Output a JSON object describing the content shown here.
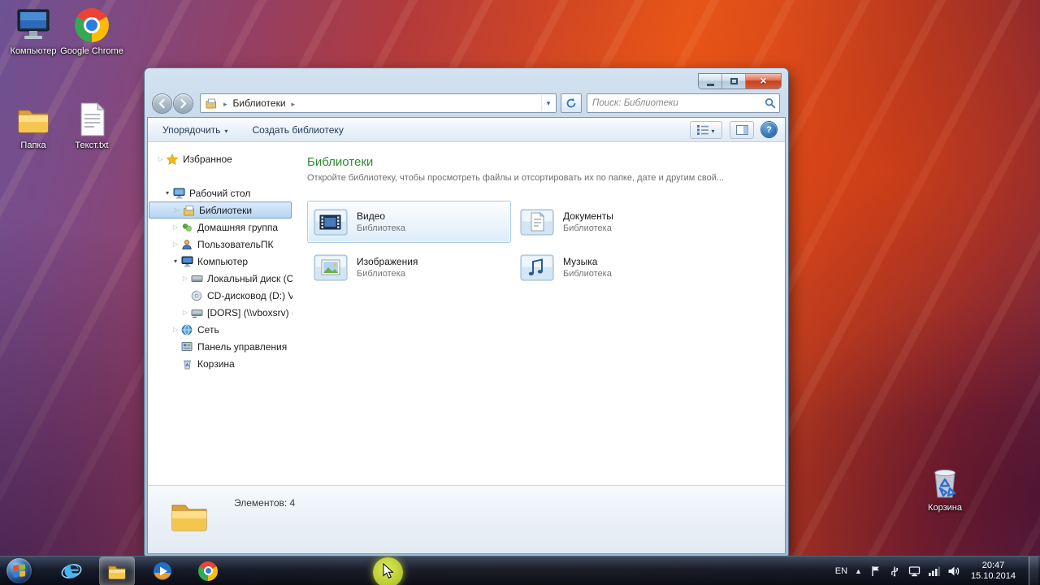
{
  "desktop": {
    "icons": [
      {
        "label": "Компьютер",
        "icon": "computer-icon"
      },
      {
        "label": "Google Chrome",
        "icon": "chrome-icon"
      },
      {
        "label": "Папка",
        "icon": "folder-icon"
      },
      {
        "label": "Текст.txt",
        "icon": "text-file-icon"
      },
      {
        "label": "Корзина",
        "icon": "recycle-bin-icon"
      }
    ]
  },
  "explorer": {
    "window_controls": [
      "minimize",
      "maximize",
      "close"
    ],
    "address": {
      "breadcrumb": "Библиотеки"
    },
    "search": {
      "placeholder": "Поиск: Библиотеки"
    },
    "toolbar": {
      "organize": "Упорядочить",
      "create_library": "Создать библиотеку"
    },
    "sidebar": {
      "items": [
        {
          "label": "Избранное",
          "icon": "star-icon",
          "indent": 0,
          "expander": "collapsed",
          "selected": false
        },
        {
          "label": "Рабочий стол",
          "icon": "desktop-icon",
          "indent": 1,
          "expander": "expanded",
          "selected": false
        },
        {
          "label": "Библиотеки",
          "icon": "libraries-icon",
          "indent": 2,
          "expander": "collapsed",
          "selected": true
        },
        {
          "label": "Домашняя группа",
          "icon": "homegroup-icon",
          "indent": 2,
          "expander": "collapsed",
          "selected": false
        },
        {
          "label": "ПользовательПК",
          "icon": "user-folder-icon",
          "indent": 2,
          "expander": "collapsed",
          "selected": false
        },
        {
          "label": "Компьютер",
          "icon": "computer-icon",
          "indent": 2,
          "expander": "expanded",
          "selected": false
        },
        {
          "label": "Локальный диск (C:)",
          "icon": "hard-disk-icon",
          "indent": 3,
          "expander": "collapsed",
          "selected": false
        },
        {
          "label": "CD-дисковод (D:) Virt...",
          "icon": "cd-drive-icon",
          "indent": 3,
          "expander": "none",
          "selected": false
        },
        {
          "label": "[DORS] (\\\\vboxsrv) (E:...",
          "icon": "network-drive-icon",
          "indent": 3,
          "expander": "collapsed",
          "selected": false
        },
        {
          "label": "Сеть",
          "icon": "network-icon",
          "indent": 2,
          "expander": "collapsed",
          "selected": false
        },
        {
          "label": "Панель управления",
          "icon": "control-panel-icon",
          "indent": 2,
          "expander": "none",
          "selected": false
        },
        {
          "label": "Корзина",
          "icon": "recycle-bin-icon",
          "indent": 2,
          "expander": "none",
          "selected": false
        }
      ]
    },
    "content": {
      "title": "Библиотеки",
      "subtitle": "Откройте библиотеку, чтобы просмотреть файлы и отсортировать их по папке, дате и другим свой...",
      "items": [
        {
          "name": "Видео",
          "type": "Библиотека",
          "icon": "video-library-icon",
          "selected": true
        },
        {
          "name": "Документы",
          "type": "Библиотека",
          "icon": "documents-library-icon",
          "selected": false
        },
        {
          "name": "Изображения",
          "type": "Библиотека",
          "icon": "pictures-library-icon",
          "selected": false
        },
        {
          "name": "Музыка",
          "type": "Библиотека",
          "icon": "music-library-icon",
          "selected": false
        }
      ]
    },
    "status": {
      "text": "Элементов: 4"
    }
  },
  "taskbar": {
    "buttons": [
      "start",
      "internet-explorer",
      "windows-explorer",
      "windows-media-player",
      "google-chrome"
    ],
    "active_button": "windows-explorer",
    "tray": {
      "language": "EN",
      "icons": [
        "hidden-icons",
        "action-center",
        "usb-device",
        "display",
        "network",
        "volume"
      ],
      "time": "20:47",
      "date": "15.10.2014"
    }
  },
  "colors": {
    "content_header_green": "#2f8b2f",
    "selection_blue": "#7da2ce",
    "cursor_highlight": "#c6d93a",
    "close_button_red": "#c6401f"
  }
}
